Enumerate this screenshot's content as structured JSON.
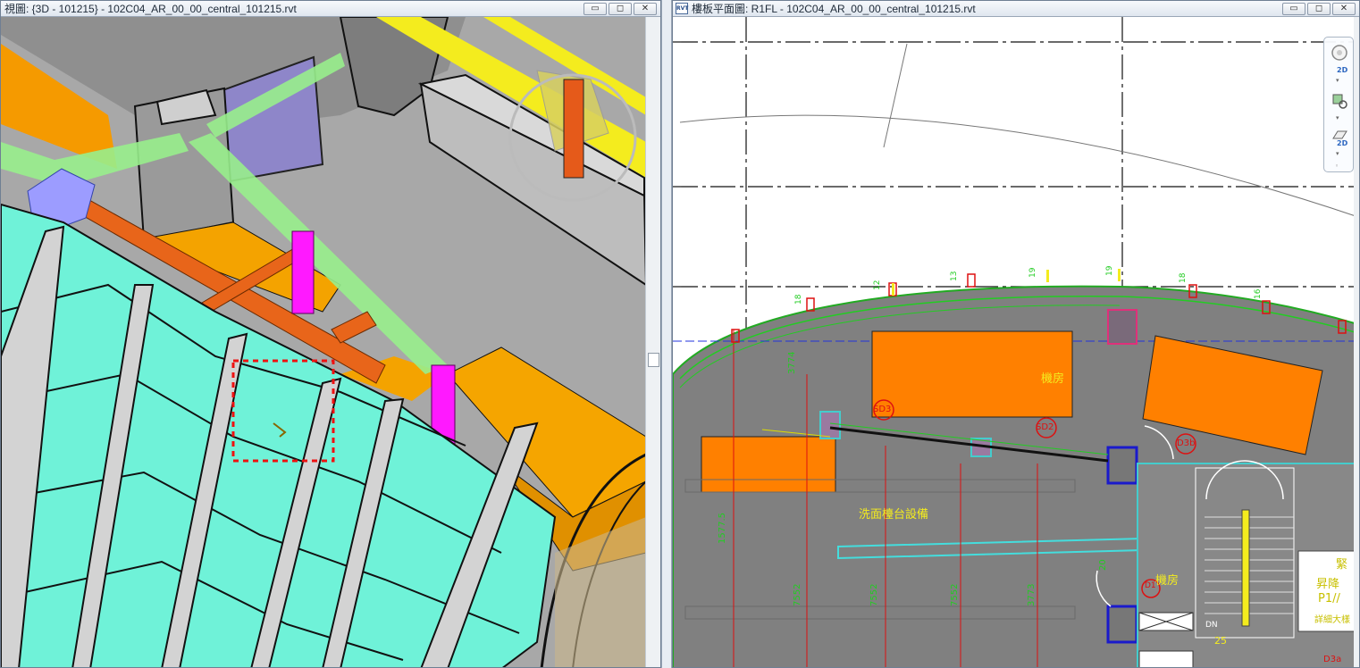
{
  "left_window": {
    "title": "視圖: {3D - 101215} - 102C04_AR_00_00_central_101215.rvt",
    "buttons": {
      "minimize": "▭",
      "restore": "◻",
      "close": "✕"
    }
  },
  "right_window": {
    "title": "樓板平面圖: R1FL - 102C04_AR_00_00_central_101215.rvt",
    "icon_text": "RVT",
    "buttons": {
      "minimize": "▭",
      "restore": "◻",
      "close": "✕"
    }
  },
  "navigation_bar": {
    "wheel_label": "2D",
    "view_label": "2D"
  },
  "plan_labels": {
    "room_1": "機房",
    "room_2": "機房",
    "equipment": "洗面檯台設備",
    "tag_sd3": "SD3",
    "tag_sd2": "SD2",
    "tag_d3b": "D3b",
    "tag_d3a": "D3a",
    "tag_d1": "D1",
    "stair_num": "25",
    "dim_a": "3774",
    "dim_b": "1577.5",
    "dim_c": "7552",
    "dim_d": "7552",
    "dim_e": "7552",
    "dim_f": "3773",
    "dim_g": "20",
    "grid_1": "18",
    "grid_2": "12",
    "grid_3": "13",
    "grid_4": "19",
    "grid_5": "19",
    "grid_6": "18",
    "grid_7": "16",
    "side_text_1": "緊",
    "side_text_2": "昇降",
    "side_text_3": "P1//",
    "side_text_4": "詳細大樣",
    "dn": "DN"
  }
}
